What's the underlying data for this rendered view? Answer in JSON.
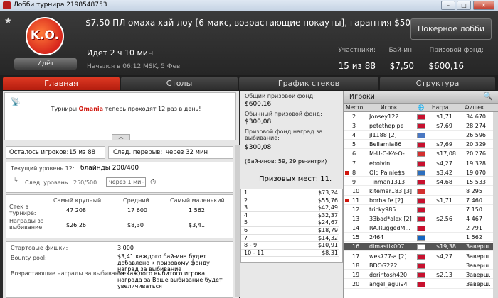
{
  "window": {
    "title": "Лобби турнира 2198548753",
    "min": "–",
    "max": "□",
    "close": "✕"
  },
  "header": {
    "title": "$7,50 ПЛ омаха хай-лоу [6-макс, возрастающие нокауты], гарантия $500",
    "logo_text": "K.O.",
    "badge": "Идёт",
    "lobby_button": "Покерное лобби",
    "running": "Идет 2 ч 10 мин",
    "started": "Начался в 06:12 MSK, 5 Фев",
    "stats": [
      {
        "label": "Участники:",
        "value": "15 из 88"
      },
      {
        "label": "Бай-ин:",
        "value": "$7,50"
      },
      {
        "label": "Призовой фонд:",
        "value": "$600,16"
      }
    ]
  },
  "tabs": [
    "Главная",
    "Столы",
    "График стеков",
    "Структура"
  ],
  "news": {
    "pre": "Турниры ",
    "highlight": "Omania",
    "post": " теперь проходят 12 раз в день!"
  },
  "remaining": {
    "label": "Осталось игроков:",
    "value": "15 из 88"
  },
  "next_break": {
    "label": "След. перерыв:",
    "value": "через 32 мин"
  },
  "level": {
    "label": "Текущий уровень 12:",
    "blinds": "блайнды 200/400",
    "next_label": "След. уровень:",
    "next_value": "250/500",
    "next_time": "через 1 мин"
  },
  "stacks": {
    "headers": [
      "Самый крупный",
      "Средний",
      "Самый маленький"
    ],
    "rows": [
      {
        "label": "Стек в турнире:",
        "values": [
          "47 208",
          "17 600",
          "1 562"
        ]
      },
      {
        "label": "Награды за выбивание:",
        "values": [
          "$26,26",
          "$8,30",
          "$3,41"
        ]
      }
    ]
  },
  "info": [
    {
      "label": "Стартовые фишки:",
      "value": "3 000"
    },
    {
      "label": "Bounty pool:",
      "value": "$3,41 каждого бай-ина будет добавлено к призовому фонду наград за выбивание"
    },
    {
      "label": "Возрастающие награды за выбивание:",
      "value": "За каждого выбитого игрока награда за Ваше выбивание будет увеличиваться"
    }
  ],
  "pools": [
    {
      "label": "Общий призовой фонд:",
      "value": "$600,16"
    },
    {
      "label": "Обычный призовой фонд:",
      "value": "$300,08"
    },
    {
      "label": "Призовой фонд наград за выбивание:",
      "value": "$300,08"
    }
  ],
  "entries_note": "(Бай-инов: 59, 29 ре-энтри)",
  "prize_places": "Призовых мест: 11.",
  "payouts": [
    [
      "1",
      "$73,24"
    ],
    [
      "2",
      "$55,76"
    ],
    [
      "3",
      "$42,49"
    ],
    [
      "4",
      "$32,37"
    ],
    [
      "5",
      "$24,67"
    ],
    [
      "6",
      "$18,79"
    ],
    [
      "7",
      "$14,32"
    ],
    [
      "8 - 9",
      "$10,91"
    ],
    [
      "10 - 11",
      "$8,31"
    ]
  ],
  "players": {
    "title": "Игроки",
    "columns": [
      "Место",
      "Игрок",
      "Награ...",
      "Фишек"
    ],
    "rows": [
      {
        "place": "2",
        "name": "Jonsey122",
        "bounty": "$1,71",
        "chips": "34 670",
        "flag": "#c8102e",
        "mark": ""
      },
      {
        "place": "3",
        "name": "petethepipe",
        "bounty": "$7,69",
        "chips": "28 274",
        "flag": "#c8102e",
        "mark": ""
      },
      {
        "place": "4",
        "name": "jl1188 [2]",
        "bounty": "",
        "chips": "26 596",
        "flag": "#4a78c2",
        "mark": ""
      },
      {
        "place": "5",
        "name": "Bellarnia86",
        "bounty": "$7,69",
        "chips": "20 329",
        "flag": "#c8102e",
        "mark": ""
      },
      {
        "place": "6",
        "name": "M-U-C-K-Y-O-...",
        "bounty": "$17,08",
        "chips": "20 276",
        "flag": "#d32f2f",
        "mark": ""
      },
      {
        "place": "7",
        "name": "eboivin",
        "bounty": "$4,27",
        "chips": "19 328",
        "flag": "#c8102e",
        "mark": ""
      },
      {
        "place": "8",
        "name": "Old Painle$$",
        "bounty": "$3,42",
        "chips": "19 070",
        "flag": "#2c6fbf",
        "mark": "red"
      },
      {
        "place": "9",
        "name": "Tinman1313",
        "bounty": "$4,68",
        "chips": "15 533",
        "flag": "#c8102e",
        "mark": ""
      },
      {
        "place": "10",
        "name": "kitemar183 [3]",
        "bounty": "",
        "chips": "8 295",
        "flag": "#d32f2f",
        "mark": ""
      },
      {
        "place": "11",
        "name": "borba fe [2]",
        "bounty": "$1,71",
        "chips": "7 460",
        "flag": "#c8102e",
        "mark": "red"
      },
      {
        "place": "12",
        "name": "tricky985",
        "bounty": "",
        "chips": "7 150",
        "flag": "#c8102e",
        "mark": ""
      },
      {
        "place": "13",
        "name": "33bad*alex [2]",
        "bounty": "$2,56",
        "chips": "4 467",
        "flag": "#c8102e",
        "mark": ""
      },
      {
        "place": "14",
        "name": "RA.RuggedM...",
        "bounty": "",
        "chips": "2 791",
        "flag": "#c8102e",
        "mark": ""
      },
      {
        "place": "15",
        "name": "2464",
        "bounty": "",
        "chips": "1 562",
        "flag": "#1565c0",
        "mark": ""
      },
      {
        "place": "16",
        "name": "dimastik007",
        "bounty": "$19,38",
        "chips": "Заверш.",
        "flag": "#fff",
        "mark": "",
        "sel": true
      },
      {
        "place": "17",
        "name": "wes777-a [2]",
        "bounty": "$4,27",
        "chips": "Заверш.",
        "flag": "#c8102e",
        "mark": ""
      },
      {
        "place": "18",
        "name": "BDOG222",
        "bounty": "",
        "chips": "Заверш.",
        "flag": "#c8102e",
        "mark": ""
      },
      {
        "place": "19",
        "name": "dorintosh420",
        "bounty": "$2,13",
        "chips": "Заверш.",
        "flag": "#c8102e",
        "mark": ""
      },
      {
        "place": "20",
        "name": "angel_agui94",
        "bounty": "",
        "chips": "Заверш.",
        "flag": "#c8102e",
        "mark": ""
      }
    ]
  }
}
